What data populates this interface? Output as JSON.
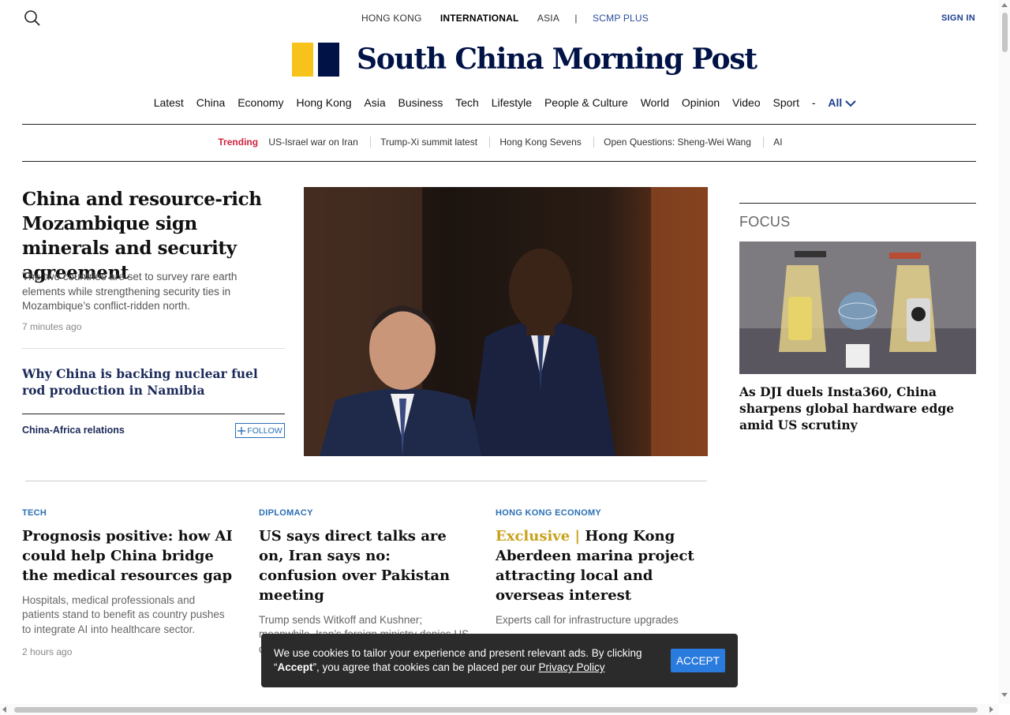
{
  "editions": {
    "hong_kong": "HONG KONG",
    "international": "INTERNATIONAL",
    "asia": "ASIA",
    "separator": "|",
    "scmp_plus": "SCMP PLUS"
  },
  "header": {
    "sign_in": "SIGN IN",
    "logo_text": "South China Morning Post"
  },
  "nav": {
    "items": [
      "Latest",
      "China",
      "Economy",
      "Hong Kong",
      "Asia",
      "Business",
      "Tech",
      "Lifestyle",
      "People & Culture",
      "World",
      "Opinion",
      "Video",
      "Sport"
    ],
    "dash": "-",
    "all": "All"
  },
  "trending": {
    "label": "Trending",
    "items": [
      "US-Israel war on Iran",
      "Trump-Xi summit latest",
      "Hong Kong Sevens",
      "Open Questions: Sheng-Wei Wang",
      "AI"
    ]
  },
  "lead": {
    "title": "China and resource-rich Mozambique sign minerals and security agreement",
    "summary": "The two countries are set to survey rare earth elements while strengthening security ties in Mozambique’s conflict-ridden north.",
    "time": "7 minutes ago",
    "related": "Why China is backing nuclear fuel rod production in Namibia",
    "topic": "China-Africa relations",
    "follow": "FOLLOW"
  },
  "focus": {
    "label": "FOCUS",
    "title": "As DJI duels Insta360, China sharpens global hardware edge amid US scrutiny"
  },
  "cards": [
    {
      "kicker": "TECH",
      "headline": "Prognosis positive: how AI could help China bridge the medical resources gap",
      "summary": "Hospitals, medical professionals and patients stand to benefit as country pushes to integrate AI into healthcare sector.",
      "time": "2 hours ago"
    },
    {
      "kicker": "DIPLOMACY",
      "headline": "US says direct talks are on, Iran says no: confusion over Pakistan meeting",
      "summary": "Trump sends Witkoff and Kushner; meanwhile, Iran’s foreign ministry denies US discussions even as Araghchi arrives in"
    },
    {
      "kicker": "HONG KONG ECONOMY",
      "exclusive": "Exclusive |",
      "headline": "Hong Kong Aberdeen marina project attracting local and overseas interest",
      "summary": "Experts call for infrastructure upgrades"
    }
  ],
  "cookie": {
    "text_before": "We use cookies to tailor your experience and present relevant ads. By clicking “",
    "accept_word": "Accept",
    "text_after": "”, you agree that cookies can be placed per our ",
    "privacy_link": "Privacy Policy",
    "button": "ACCEPT"
  },
  "colors": {
    "brand_navy": "#001246",
    "brand_yellow": "#f7c219",
    "trending_red": "#d0213d",
    "kicker_blue": "#2a6fb5",
    "exclusive_gold": "#c9a21b"
  }
}
